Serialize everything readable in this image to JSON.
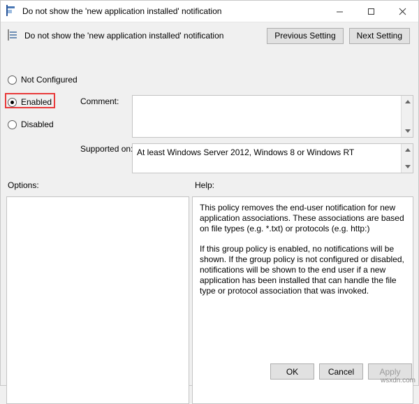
{
  "window": {
    "title": "Do not show the 'new application installed' notification",
    "icon": "group-policy-icon",
    "caption": {
      "minimize": "minimize-icon",
      "maximize": "maximize-icon",
      "close": "close-icon"
    }
  },
  "header": {
    "title": "Do not show the 'new application installed' notification",
    "previous_label": "Previous Setting",
    "next_label": "Next Setting"
  },
  "state": {
    "options": [
      {
        "label": "Not Configured",
        "selected": false
      },
      {
        "label": "Enabled",
        "selected": true
      },
      {
        "label": "Disabled",
        "selected": false
      }
    ],
    "highlight_color": "#e8393a"
  },
  "comment": {
    "label": "Comment:",
    "value": ""
  },
  "supported": {
    "label": "Supported on:",
    "value": "At least Windows Server 2012, Windows 8 or Windows RT"
  },
  "options_pane": {
    "label": "Options:",
    "content": ""
  },
  "help_pane": {
    "label": "Help:",
    "paragraphs": [
      "This policy removes the end-user notification for new application associations. These associations are based on file types (e.g. *.txt) or protocols (e.g. http:)",
      "If this group policy is enabled, no notifications will be shown. If the group policy is not configured or disabled, notifications will be shown to the end user if a new application has been installed that can handle the file type or protocol association that was invoked."
    ]
  },
  "footer": {
    "ok_label": "OK",
    "cancel_label": "Cancel",
    "apply_label": "Apply"
  },
  "watermark": "wsxdn.com"
}
